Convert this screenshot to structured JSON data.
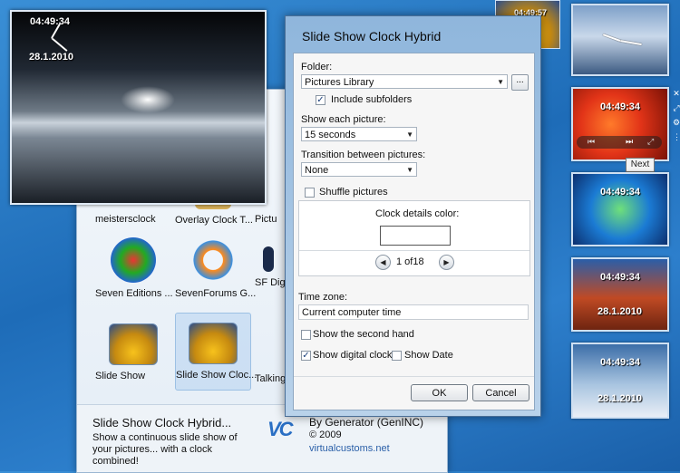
{
  "preview_clock": {
    "time": "04:49:34",
    "date": "28.1.2010"
  },
  "mini_clock": {
    "time": "04:49:57"
  },
  "gallery": {
    "items": [
      {
        "label": "meistersclock"
      },
      {
        "label": "Overlay Clock T..."
      },
      {
        "label": "Pictu"
      },
      {
        "label": "Seven Editions ..."
      },
      {
        "label": "SevenForums G..."
      },
      {
        "label": "SF Dig"
      },
      {
        "label": "Slide Show"
      },
      {
        "label": "Slide Show Cloc..."
      },
      {
        "label": "Talking"
      }
    ],
    "footer": {
      "title": "Slide Show Clock Hybrid...",
      "description": "Show a continuous slide show of your pictures... with a clock combined!",
      "logo": "VC",
      "author": "By Generator (GenINC)",
      "copyright": "© 2009",
      "link": "virtualcustoms.net"
    }
  },
  "dialog": {
    "title": "Slide Show Clock Hybrid",
    "folder_label": "Folder:",
    "folder_value": "Pictures Library",
    "browse_label": "...",
    "include_subfolders": "Include subfolders",
    "show_each_label": "Show each picture:",
    "show_each_value": "15 seconds",
    "transition_label": "Transition between pictures:",
    "transition_value": "None",
    "shuffle_label": "Shuffle pictures",
    "clock_color_label": "Clock details color:",
    "page_indicator": "1 of18",
    "timezone_label": "Time zone:",
    "timezone_value": "Current computer time",
    "second_hand_label": "Show the second hand",
    "digital_clock_label": "Show digital clock",
    "show_date_label": "Show Date",
    "ok_label": "OK",
    "cancel_label": "Cancel",
    "checkbox_states": {
      "include_subfolders": true,
      "shuffle": false,
      "second_hand": false,
      "digital_clock": true,
      "show_date": false
    }
  },
  "sidebar": {
    "thumbs": [
      {
        "time": "",
        "date": ""
      },
      {
        "time": "04:49:34",
        "date": ""
      },
      {
        "time": "04:49:34",
        "date": ""
      },
      {
        "time": "04:49:34",
        "date": "28.1.2010"
      },
      {
        "time": "04:49:34",
        "date": "28.1.2010"
      }
    ],
    "tooltip": "Next"
  }
}
